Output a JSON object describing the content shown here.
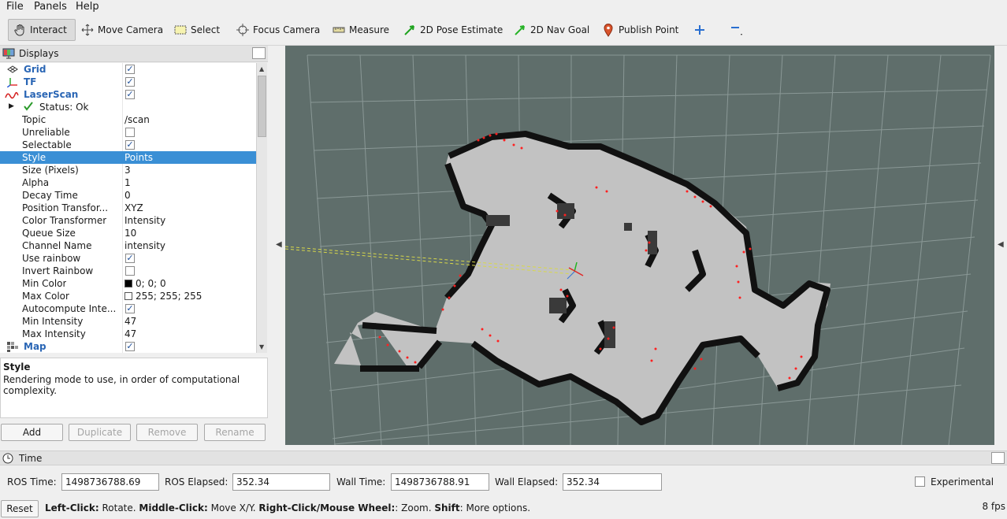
{
  "menu": {
    "file": "File",
    "panels": "Panels",
    "help": "Help"
  },
  "toolbar": {
    "interact": "Interact",
    "move_camera": "Move Camera",
    "select": "Select",
    "focus_camera": "Focus Camera",
    "measure": "Measure",
    "pose_estimate": "2D Pose Estimate",
    "nav_goal": "2D Nav Goal",
    "publish_point": "Publish Point"
  },
  "displays": {
    "title": "Displays",
    "rows": {
      "grid": "Grid",
      "tf": "TF",
      "laserscan": "LaserScan",
      "status": "Status: Ok",
      "topic_k": "Topic",
      "topic_v": "/scan",
      "unreliable": "Unreliable",
      "selectable": "Selectable",
      "style_k": "Style",
      "style_v": "Points",
      "size_k": "Size (Pixels)",
      "size_v": "3",
      "alpha_k": "Alpha",
      "alpha_v": "1",
      "decay_k": "Decay Time",
      "decay_v": "0",
      "postf_k": "Position Transfor...",
      "postf_v": "XYZ",
      "coltf_k": "Color Transformer",
      "coltf_v": "Intensity",
      "queue_k": "Queue Size",
      "queue_v": "10",
      "chan_k": "Channel Name",
      "chan_v": "intensity",
      "rainbow": "Use rainbow",
      "invert": "Invert Rainbow",
      "minc_k": "Min Color",
      "minc_v": "0; 0; 0",
      "maxc_k": "Max Color",
      "maxc_v": "255; 255; 255",
      "auto": "Autocompute Inte...",
      "mini_k": "Min Intensity",
      "mini_v": "47",
      "maxi_k": "Max Intensity",
      "maxi_v": "47",
      "map": "Map"
    }
  },
  "description": {
    "title": "Style",
    "text": "Rendering mode to use, in order of computational complexity."
  },
  "buttons": {
    "add": "Add",
    "duplicate": "Duplicate",
    "remove": "Remove",
    "rename": "Rename"
  },
  "time": {
    "title": "Time",
    "ros_time_label": "ROS Time:",
    "ros_time": "1498736788.69",
    "ros_elapsed_label": "ROS Elapsed:",
    "ros_elapsed": "352.34",
    "wall_time_label": "Wall Time:",
    "wall_time": "1498736788.91",
    "wall_elapsed_label": "Wall Elapsed:",
    "wall_elapsed": "352.34",
    "experimental": "Experimental"
  },
  "status": {
    "reset": "Reset",
    "left_click": "Left-Click:",
    "rotate": " Rotate. ",
    "middle_click": "Middle-Click:",
    "move": " Move X/Y. ",
    "right_click": "Right-Click/Mouse Wheel:",
    "zoom": ": Zoom. ",
    "shift": "Shift",
    "more": ": More options.",
    "fps": "8 fps"
  },
  "colors": {
    "selection": "#3a8fd5",
    "viewport_bg": "#5f6e6b",
    "laser": "#ff2020",
    "map_free": "#c2c2c2",
    "map_wall": "#111111"
  }
}
